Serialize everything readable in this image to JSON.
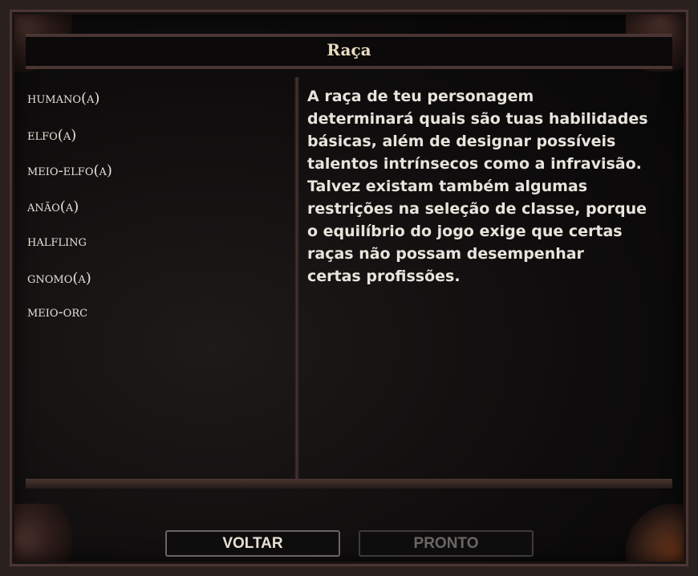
{
  "title": "Raça",
  "races": [
    "HUMANO(A)",
    "ELFO(A)",
    "MEIO-ELFO(A)",
    "ANÃO(A)",
    "HALFLING",
    "GNOMO(A)",
    "MEIO-ORC"
  ],
  "description": "A raça de teu personagem\ndeterminará quais são tuas habilidades\nbásicas, além de designar possíveis\ntalentos intrínsecos como a infravisão.\nTalvez existam também algumas\nrestrições na seleção de classe, porque\no equilíbrio do jogo exige que certas\nraças não possam desempenhar\ncertas profissões.",
  "buttons": {
    "back": "VOLTAR",
    "done": "PRONTO"
  }
}
